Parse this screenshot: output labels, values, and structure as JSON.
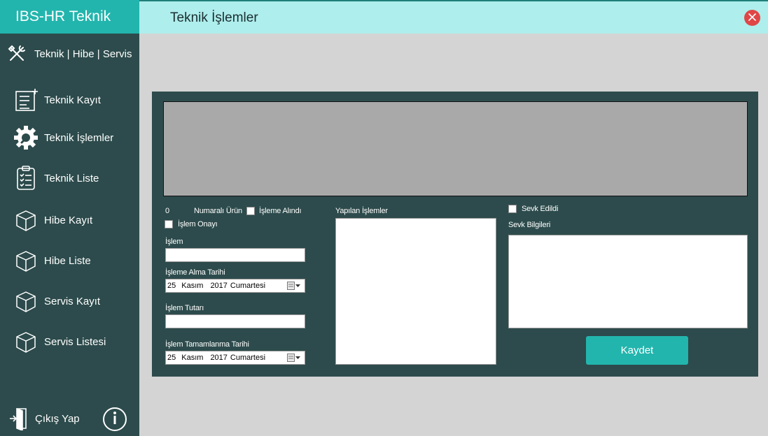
{
  "sidebar": {
    "brand": "IBS-HR Teknik",
    "module": "Teknik | Hibe | Servis",
    "items": [
      {
        "label": "Teknik Kayıt",
        "icon": "form-add-icon"
      },
      {
        "label": "Teknik İşlemler",
        "icon": "gear-wrench-icon"
      },
      {
        "label": "Teknik Liste",
        "icon": "clipboard-checklist-icon"
      },
      {
        "label": "Hibe Kayıt",
        "icon": "box-icon"
      },
      {
        "label": "Hibe Liste",
        "icon": "box-icon"
      },
      {
        "label": "Servis Kayıt",
        "icon": "box-icon"
      },
      {
        "label": "Servis Listesi",
        "icon": "box-icon"
      }
    ],
    "logout": "Çıkış Yap"
  },
  "header": {
    "title": "Teknik İşlemler"
  },
  "form": {
    "product_number": "0",
    "product_label": "Numaralı Ürün",
    "received_label": "İşleme Alındı",
    "approval_label": "İşlem Onayı",
    "islem_label": "İşlem",
    "islem_value": "",
    "alma_tarihi_label": "İşleme Alma Tarihi",
    "alma_tarihi": {
      "day": "25",
      "month": "Kasım",
      "year": "2017",
      "weekday": "Cumartesi"
    },
    "tutar_label": "İşlem Tutarı",
    "tutar_value": "",
    "tamamlanma_label": "İşlem Tamamlanma Tarihi",
    "tamamlanma_tarihi": {
      "day": "25",
      "month": "Kasım",
      "year": "2017",
      "weekday": "Cumartesi"
    },
    "yapilan_label": "Yapılan İşlemler",
    "yapilan_value": "",
    "sevk_edildi_label": "Sevk Edildi",
    "sevk_bilgileri_label": "Sevk Bilgileri",
    "sevk_bilgileri_value": "",
    "save_label": "Kaydet"
  },
  "colors": {
    "sidebar_bg": "#2d4b4c",
    "brand_bg": "#22b5ad",
    "header_bg": "#aeeeec",
    "accent": "#22b5ad",
    "close": "#e04646"
  }
}
